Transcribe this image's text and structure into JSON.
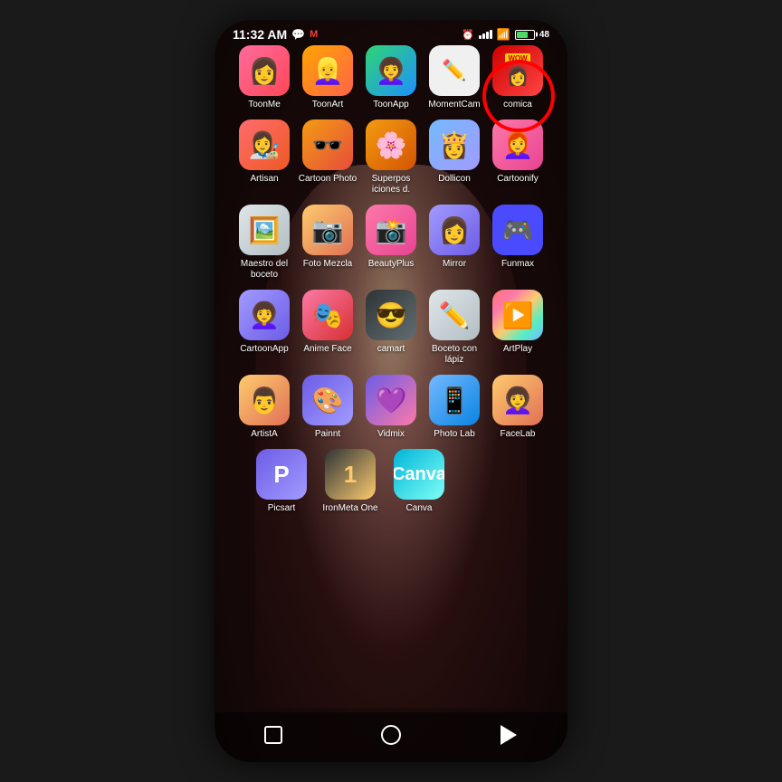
{
  "phone": {
    "status_bar": {
      "time": "11:32 AM",
      "battery_percent": "48"
    },
    "highlight": {
      "app_name": "comica",
      "description": "Red circle highlight around comica app"
    },
    "app_rows": [
      {
        "row": 1,
        "apps": [
          {
            "id": "toonme",
            "label": "ToonMe",
            "icon_class": "icon-toonme",
            "emoji": "👩"
          },
          {
            "id": "toonart",
            "label": "ToonArt",
            "icon_class": "icon-toonart",
            "emoji": "👱‍♀️"
          },
          {
            "id": "toonapp",
            "label": "ToonApp",
            "icon_class": "icon-toonapp",
            "emoji": "👩‍🦱"
          },
          {
            "id": "momentcam",
            "label": "MomentCam",
            "icon_class": "icon-momentcam",
            "emoji": "✏️"
          },
          {
            "id": "comica",
            "label": "comica",
            "icon_class": "icon-comica",
            "emoji": "WOW"
          }
        ]
      },
      {
        "row": 2,
        "apps": [
          {
            "id": "artisan",
            "label": "Artisan",
            "icon_class": "icon-artisan",
            "emoji": "👩‍🎨"
          },
          {
            "id": "cartoonphoto",
            "label": "Cartoon Photo",
            "icon_class": "icon-cartoonphoto",
            "emoji": "🕶️"
          },
          {
            "id": "superpos",
            "label": "Superposiciones d.",
            "icon_class": "icon-superpos",
            "emoji": "🌸"
          },
          {
            "id": "dollicon",
            "label": "Dollicon",
            "icon_class": "icon-dollicon",
            "emoji": "👸"
          },
          {
            "id": "cartoonify",
            "label": "Cartoonify",
            "icon_class": "icon-cartoonify",
            "emoji": "👩‍🦰"
          }
        ]
      },
      {
        "row": 3,
        "apps": [
          {
            "id": "maestro",
            "label": "Maestro del boceto",
            "icon_class": "icon-maestro",
            "emoji": "🖼️"
          },
          {
            "id": "foto",
            "label": "Foto Mezcla",
            "icon_class": "icon-foto",
            "emoji": "📷"
          },
          {
            "id": "beautyplus",
            "label": "BeautyPlus",
            "icon_class": "icon-beautyplus",
            "emoji": "📸"
          },
          {
            "id": "mirror",
            "label": "Mirror",
            "icon_class": "icon-mirror",
            "emoji": "👩"
          },
          {
            "id": "funmax",
            "label": "Funmax",
            "icon_class": "icon-funmax",
            "emoji": "🎮"
          }
        ]
      },
      {
        "row": 4,
        "apps": [
          {
            "id": "cartoonapp",
            "label": "CartoonApp",
            "icon_class": "icon-cartoonapp",
            "emoji": "👩‍🦱"
          },
          {
            "id": "animeface",
            "label": "Anime Face",
            "icon_class": "icon-animeface",
            "emoji": "🎭"
          },
          {
            "id": "camart",
            "label": "camart",
            "icon_class": "icon-camart",
            "emoji": "😎"
          },
          {
            "id": "boceto",
            "label": "Boceto con lápiz",
            "icon_class": "icon-boceto",
            "emoji": "✏️"
          },
          {
            "id": "artplay",
            "label": "ArtPlay",
            "icon_class": "icon-artplay",
            "emoji": "▶️"
          }
        ]
      },
      {
        "row": 5,
        "apps": [
          {
            "id": "artista",
            "label": "ArtistA",
            "icon_class": "icon-artista",
            "emoji": "👨"
          },
          {
            "id": "painnt",
            "label": "Painnt",
            "icon_class": "icon-painnt",
            "emoji": "🎨"
          },
          {
            "id": "vidmix",
            "label": "Vidmix",
            "icon_class": "icon-vidmix",
            "emoji": "💜"
          },
          {
            "id": "photolab",
            "label": "Photo Lab",
            "icon_class": "icon-photolab",
            "emoji": "📱"
          },
          {
            "id": "facelab",
            "label": "FaceLab",
            "icon_class": "icon-facelab",
            "emoji": "👩‍🦱"
          }
        ]
      },
      {
        "row": 6,
        "apps": [
          {
            "id": "picsart",
            "label": "Picsart",
            "icon_class": "icon-picsart",
            "emoji": "P"
          },
          {
            "id": "ironmeta",
            "label": "IronMeta One",
            "icon_class": "icon-ironmeta",
            "emoji": "1"
          },
          {
            "id": "canva",
            "label": "Canva",
            "icon_class": "icon-canva",
            "emoji": "C"
          }
        ]
      }
    ],
    "bottom_nav": {
      "square_label": "recent",
      "circle_label": "home",
      "triangle_label": "back"
    }
  }
}
